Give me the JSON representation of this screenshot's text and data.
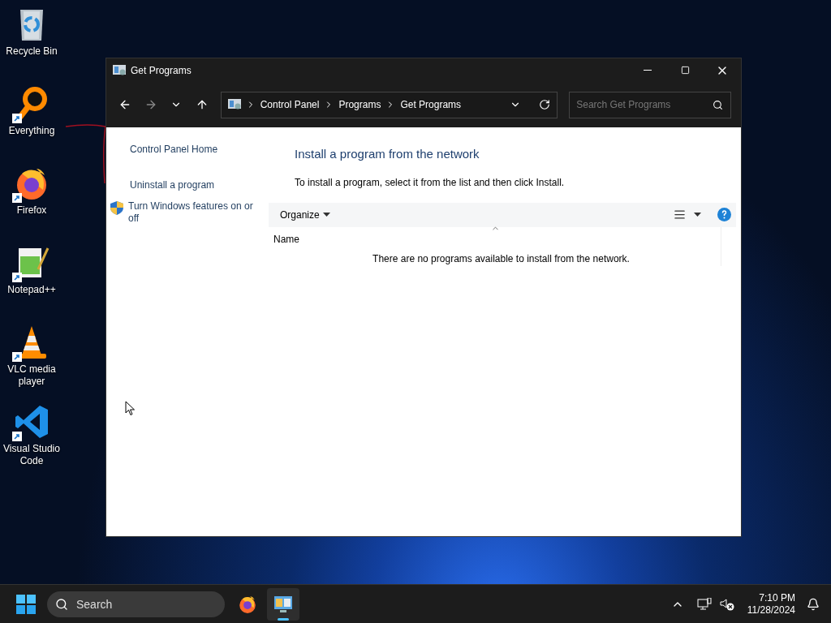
{
  "desktop_icons": [
    {
      "kind": "recycle",
      "label": "Recycle Bin",
      "shortcut": false
    },
    {
      "kind": "search-ring",
      "label": "Everything",
      "shortcut": true
    },
    {
      "kind": "fox",
      "label": "Firefox",
      "shortcut": true
    },
    {
      "kind": "notepad",
      "label": "Notepad++",
      "shortcut": true
    },
    {
      "kind": "cone",
      "label": "VLC media player",
      "shortcut": true
    },
    {
      "kind": "code",
      "label": "Visual Studio Code",
      "shortcut": true
    }
  ],
  "window": {
    "title": "Get Programs",
    "breadcrumb": [
      "Control Panel",
      "Programs",
      "Get Programs"
    ],
    "search": {
      "placeholder": "Search Get Programs"
    },
    "sidebar": [
      {
        "kind": "link",
        "label": "Control Panel Home"
      },
      {
        "kind": "link",
        "label": "Uninstall a program"
      },
      {
        "kind": "shield-link",
        "label": "Turn Windows features on or off"
      }
    ],
    "heading": "Install a program from the network",
    "instruction": "To install a program, select it from the list and then click Install.",
    "toolbar": {
      "organize": "Organize"
    },
    "columns": [
      "Name"
    ],
    "empty_message": "There are no programs available to install from the network."
  },
  "taskbar": {
    "search": {
      "placeholder": "Search"
    },
    "apps": [
      {
        "kind": "fox",
        "selected": false
      },
      {
        "kind": "control-panel",
        "selected": true
      }
    ],
    "time": "7:10 PM",
    "date": "11/28/2024"
  }
}
